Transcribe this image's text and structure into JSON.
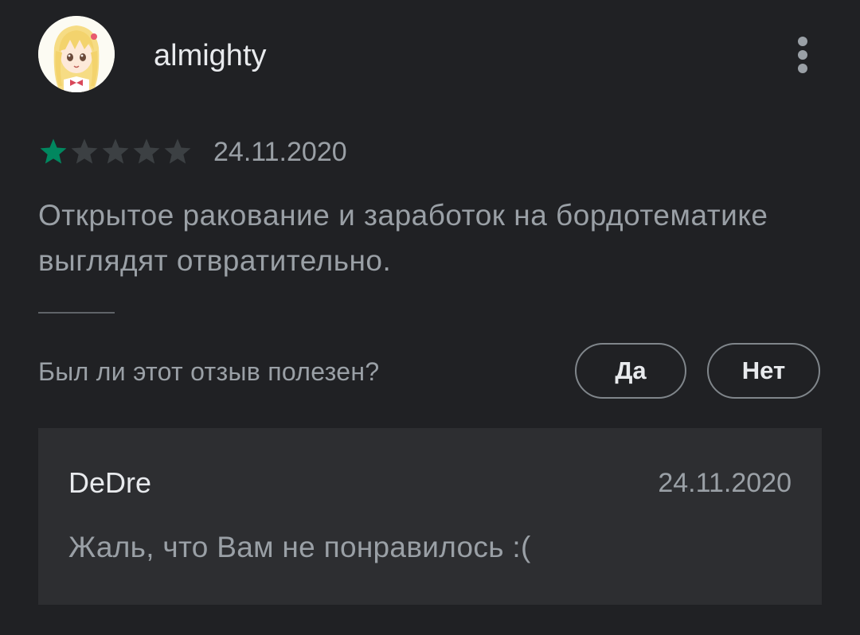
{
  "review": {
    "username": "almighty",
    "rating": 1,
    "max_rating": 5,
    "date": "24.11.2020",
    "text": "Открытое раковaние и заработок на бордотематике выглядят отвратительно."
  },
  "helpful": {
    "question": "Был ли этот отзыв полезен?",
    "yes_label": "Да",
    "no_label": "Нет"
  },
  "developer_reply": {
    "author": "DeDre",
    "date": "24.11.2020",
    "text": "Жаль, что Вам не понравилось :("
  },
  "colors": {
    "background": "#202124",
    "star_filled": "#01875f",
    "star_empty": "#3c4043",
    "reply_background": "#2d2e31"
  },
  "icons": {
    "menu": "more-vert-icon",
    "star": "star-icon"
  }
}
